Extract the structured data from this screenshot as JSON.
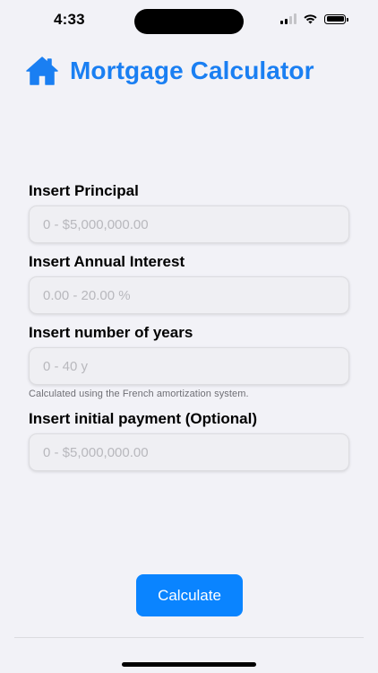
{
  "status_bar": {
    "time": "4:33"
  },
  "header": {
    "title": "Mortgage Calculator",
    "icon": "house-icon",
    "accent_color": "#1a7ff2"
  },
  "form": {
    "principal": {
      "label": "Insert Principal",
      "placeholder": "0 - $5,000,000.00",
      "value": ""
    },
    "interest": {
      "label": "Insert Annual Interest",
      "placeholder": "0.00 - 20.00 %",
      "value": ""
    },
    "years": {
      "label": "Insert number of years",
      "placeholder": "0 - 40 y",
      "value": "",
      "caption": "Calculated using the French amortization system."
    },
    "initial_payment": {
      "label": "Insert initial payment (Optional)",
      "placeholder": "0 - $5,000,000.00",
      "value": ""
    }
  },
  "actions": {
    "calculate_label": "Calculate",
    "button_color": "#0a84ff"
  }
}
